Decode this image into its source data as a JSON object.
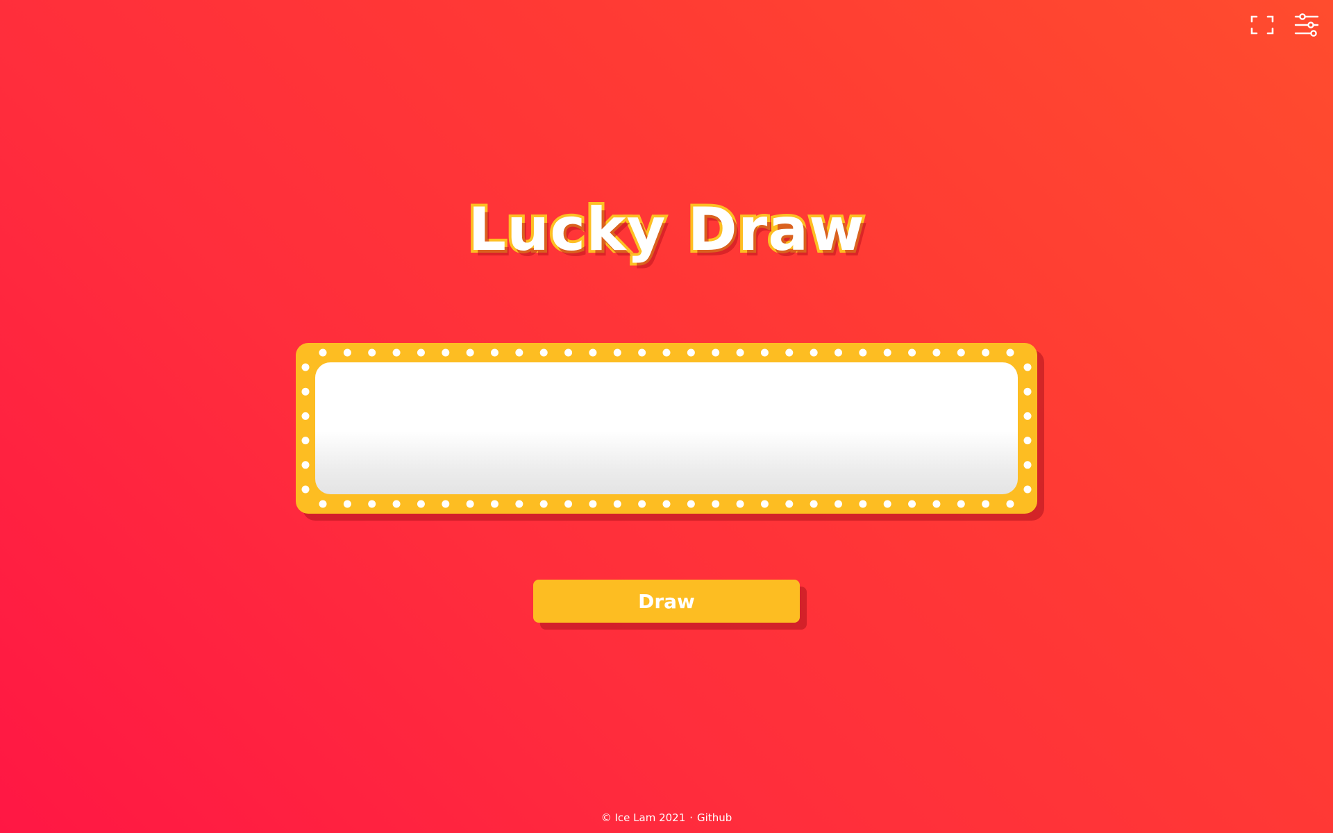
{
  "controls": {
    "fullscreen_icon": "fullscreen-icon",
    "settings_icon": "settings-sliders-icon"
  },
  "title": "Lucky Draw",
  "board": {
    "result_text": ""
  },
  "draw_button": {
    "label": "Draw"
  },
  "footer": {
    "copyright": "© Ice Lam 2021",
    "separator": "·",
    "link_label": "Github"
  },
  "colors": {
    "background_start": "#ff1744",
    "background_end": "#ff4c2e",
    "accent_yellow": "#fdbd22",
    "text_white": "#ffffff"
  }
}
